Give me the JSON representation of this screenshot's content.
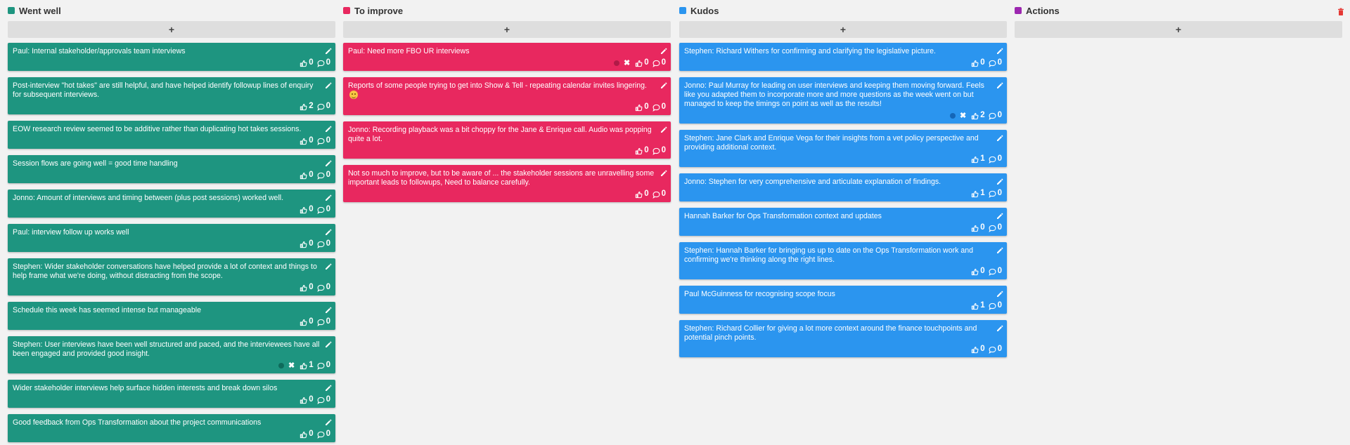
{
  "columns": [
    {
      "id": "went-well",
      "title": "Went well",
      "color": "#1e9580",
      "add_label": "+",
      "cards": [
        {
          "text": "Paul: Internal stakeholder/approvals team interviews",
          "likes": "0",
          "comments": "0"
        },
        {
          "text": "Post-interview \"hot takes\" are still helpful, and have helped identify followup lines of enquiry for subsequent interviews.",
          "likes": "2",
          "comments": "0"
        },
        {
          "text": "EOW research review seemed to be additive rather than duplicating hot takes sessions.",
          "likes": "0",
          "comments": "0"
        },
        {
          "text": "Session flows are going well = good time handling",
          "likes": "0",
          "comments": "0"
        },
        {
          "text": "Jonno: Amount of interviews and timing between (plus post sessions) worked well.",
          "likes": "0",
          "comments": "0"
        },
        {
          "text": "Paul: interview follow up works well",
          "likes": "0",
          "comments": "0"
        },
        {
          "text": "Stephen: Wider stakeholder conversations have helped provide a lot of context and things to help frame what we're doing, without distracting from the scope.",
          "likes": "0",
          "comments": "0"
        },
        {
          "text": "Schedule this week has seemed intense but manageable",
          "likes": "0",
          "comments": "0"
        },
        {
          "text": "Stephen: User interviews have been well structured and paced, and the interviewees have all been engaged and provided good insight.",
          "likes": "1",
          "comments": "0",
          "has_reaction": true,
          "reaction_color": "#0e6b5b"
        },
        {
          "text": "Wider stakeholder interviews help surface hidden interests and break down silos",
          "likes": "0",
          "comments": "0"
        },
        {
          "text": "Good feedback from Ops Transformation about the project communications",
          "likes": "0",
          "comments": "0"
        }
      ]
    },
    {
      "id": "to-improve",
      "title": "To improve",
      "color": "#e8285f",
      "add_label": "+",
      "cards": [
        {
          "text": "Paul: Need more FBO UR interviews",
          "likes": "0",
          "comments": "0",
          "has_reaction": true,
          "reaction_color": "#b01a47"
        },
        {
          "text": "Reports of some people trying to get into Show & Tell - repeating calendar invites lingering.",
          "likes": "0",
          "comments": "0",
          "emoji": "grin-emoji"
        },
        {
          "text": "Jonno: Recording playback was a bit choppy for the Jane & Enrique call. Audio was popping quite a lot.",
          "likes": "0",
          "comments": "0"
        },
        {
          "text": "Not so much to improve, but to be aware of ... the stakeholder sessions are unravelling some important leads to followups, Need to balance carefully.",
          "likes": "0",
          "comments": "0"
        }
      ]
    },
    {
      "id": "kudos",
      "title": "Kudos",
      "color": "#2b95ef",
      "add_label": "+",
      "cards": [
        {
          "text": "Stephen: Richard Withers for confirming and clarifying the legislative picture.",
          "likes": "0",
          "comments": "0"
        },
        {
          "text": "Jonno: Paul Murray for leading on user interviews and keeping them moving forward. Feels like you adapted them to incorporate more and more questions as the week went on but managed to keep the timings on point as well as the results!",
          "likes": "2",
          "comments": "0",
          "has_reaction": true,
          "reaction_color": "#1466b8"
        },
        {
          "text": "Stephen: Jane Clark and Enrique Vega for their insights from a vet policy perspective and providing additional context.",
          "likes": "1",
          "comments": "0"
        },
        {
          "text": "Jonno: Stephen for very comprehensive and articulate explanation of findings.",
          "likes": "1",
          "comments": "0"
        },
        {
          "text": "Hannah Barker for Ops Transformation context and updates",
          "likes": "0",
          "comments": "0"
        },
        {
          "text": "Stephen: Hannah Barker for bringing us up to date on the Ops Transformation work and confirming we're thinking along the right lines.",
          "likes": "0",
          "comments": "0"
        },
        {
          "text": "Paul McGuinness for recognising scope focus",
          "likes": "1",
          "comments": "0"
        },
        {
          "text": "Stephen: Richard Collier for giving a lot more context around the finance touchpoints and potential pinch points.",
          "likes": "0",
          "comments": "0"
        }
      ]
    },
    {
      "id": "actions",
      "title": "Actions",
      "color": "#9c27b0",
      "add_label": "+",
      "delete_icon": "trash-icon",
      "delete_color": "#e53935",
      "cards": []
    }
  ],
  "icons": {
    "edit": "pencil-icon",
    "like": "thumbs-up-icon",
    "comment": "speech-bubble-icon",
    "remove_reaction": "x-icon"
  }
}
